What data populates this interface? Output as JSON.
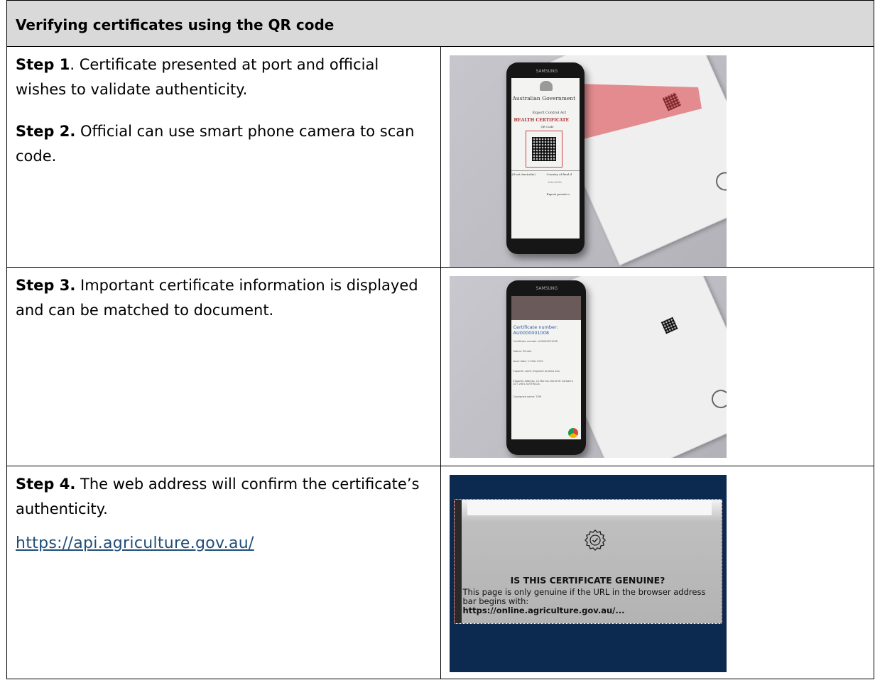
{
  "header": {
    "title": "Verifying certificates using the QR code"
  },
  "rows": [
    {
      "paragraphs": [
        {
          "label": "Step 1",
          "text": ". Certificate presented at port and official wishes to validate authenticity."
        },
        {
          "label": "Step 2.",
          "text": " Official can use smart phone camera to scan code."
        }
      ],
      "image": {
        "phone_brand": "SAMSUNG",
        "screen_title": "Australian Government",
        "screen_subtitle": "Export Control Act",
        "screen_heading": "HEALTH CERTIFICATE",
        "screen_qr_label": "QR Code",
        "screen_left_cell": "(if not Australia)",
        "screen_right_cell": "Country of final d",
        "screen_right_value": "MALAYSIA",
        "screen_bottom_cell": "Export permit n"
      }
    },
    {
      "paragraphs": [
        {
          "label": "Step 3.",
          "text": " Important certificate information is displayed and can be matched to document."
        }
      ],
      "image": {
        "phone_brand": "SAMSUNG",
        "screen_cert_label": "Certificate number:",
        "screen_cert_value": "AU0000001008",
        "screen_lines": [
          "Certificate number: AU0000001008",
          "Status: Printed",
          "Issue date: 11 Mar 2021",
          "Exporter name: Exporter Andrew Ann",
          "Exporter address: 12 Marcus Clarke St Canberra ACT 2601 AUSTRALIA",
          "Consignee name: TOM"
        ]
      }
    },
    {
      "paragraphs": [
        {
          "label": "Step 4.",
          "text": " The web address will confirm the certificate’s authenticity."
        }
      ],
      "link": "https://api.agriculture.gov.au/",
      "image": {
        "title": "IS THIS CERTIFICATE GENUINE?",
        "body": "This page is only genuine if the URL in the browser address bar begins with:",
        "url": "https://online.agriculture.gov.au/..."
      }
    }
  ],
  "colors": {
    "header_bg": "#d9d9d9",
    "link": "#1f4e79",
    "banner_bg": "#0c2a50"
  }
}
